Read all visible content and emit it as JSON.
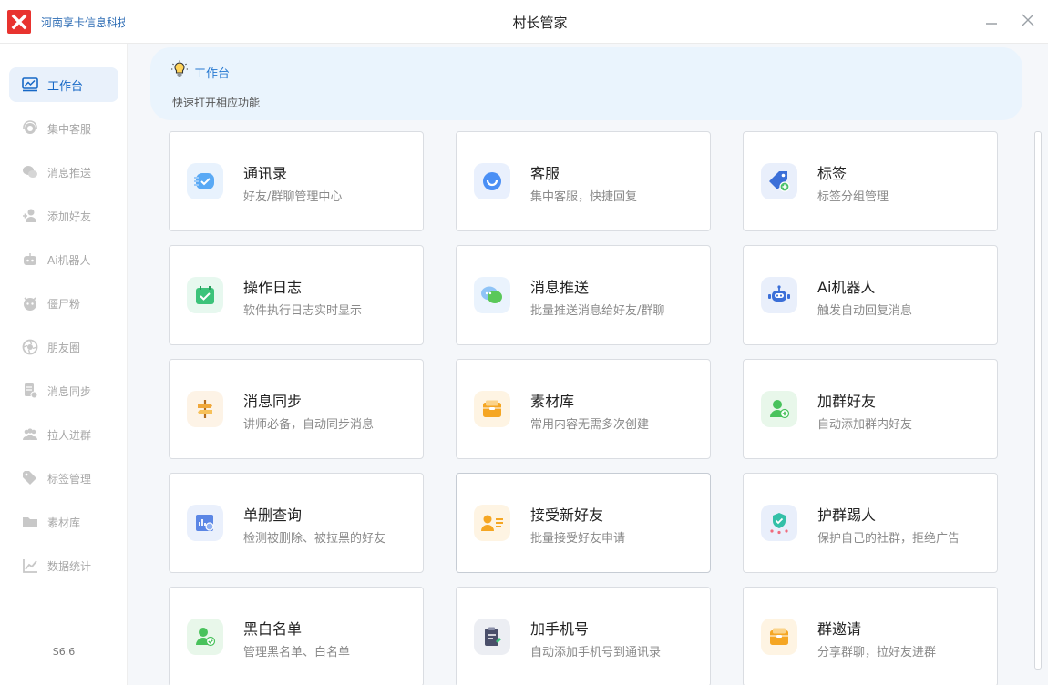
{
  "window": {
    "company": "河南享卡信息科技",
    "title": "村长管家",
    "version": "S6.6"
  },
  "sidebar": {
    "items": [
      {
        "label": "工作台",
        "icon": "workbench-icon",
        "active": true
      },
      {
        "label": "集中客服",
        "icon": "customer-service-icon"
      },
      {
        "label": "消息推送",
        "icon": "chat-bubbles-icon"
      },
      {
        "label": "添加好友",
        "icon": "add-friend-icon"
      },
      {
        "label": "Ai机器人",
        "icon": "robot-icon"
      },
      {
        "label": "僵尸粉",
        "icon": "zombie-icon"
      },
      {
        "label": "朋友圈",
        "icon": "aperture-icon"
      },
      {
        "label": "消息同步",
        "icon": "sync-doc-icon"
      },
      {
        "label": "拉人进群",
        "icon": "group-icon"
      },
      {
        "label": "标签管理",
        "icon": "tag-icon"
      },
      {
        "label": "素材库",
        "icon": "folder-icon"
      },
      {
        "label": "数据统计",
        "icon": "chart-icon"
      }
    ]
  },
  "banner": {
    "title": "工作台",
    "subtitle": "快速打开相应功能",
    "icon": "lightbulb-icon"
  },
  "cards": [
    {
      "title": "通讯录",
      "desc": "好友/群聊管理中心",
      "icon": "contacts-icon",
      "color": "#4a9ff5"
    },
    {
      "title": "客服",
      "desc": "集中客服，快捷回复",
      "icon": "service-icon",
      "color": "#4a8ff5"
    },
    {
      "title": "标签",
      "desc": "标签分组管理",
      "icon": "tag-icon",
      "color": "#3b6fd8"
    },
    {
      "title": "操作日志",
      "desc": "软件执行日志实时显示",
      "icon": "calendar-check-icon",
      "color": "#3cc37a"
    },
    {
      "title": "消息推送",
      "desc": "批量推送消息给好友/群聊",
      "icon": "chat-icon",
      "color": "#5ac85a"
    },
    {
      "title": "Ai机器人",
      "desc": "触发自动回复消息",
      "icon": "robot-icon",
      "color": "#3b6fd8"
    },
    {
      "title": "消息同步",
      "desc": "讲师必备，自动同步消息",
      "icon": "signpost-icon",
      "color": "#f0a83c"
    },
    {
      "title": "素材库",
      "desc": "常用内容无需多次创建",
      "icon": "folder-icon",
      "color": "#f5a623"
    },
    {
      "title": "加群好友",
      "desc": "自动添加群内好友",
      "icon": "add-user-icon",
      "color": "#49c25c"
    },
    {
      "title": "单删查询",
      "desc": "检测被删除、被拉黑的好友",
      "icon": "report-icon",
      "color": "#5b86e5"
    },
    {
      "title": "接受新好友",
      "desc": "批量接受好友申请",
      "icon": "id-card-icon",
      "color": "#f5a623"
    },
    {
      "title": "护群踢人",
      "desc": "保护自己的社群，拒绝广告",
      "icon": "shield-icon",
      "color": "#33c0a8"
    },
    {
      "title": "黑白名单",
      "desc": "管理黑名单、白名单",
      "icon": "user-check-icon",
      "color": "#49c25c"
    },
    {
      "title": "加手机号",
      "desc": "自动添加手机号到通讯录",
      "icon": "clipboard-icon",
      "color": "#4a4f6a"
    },
    {
      "title": "群邀请",
      "desc": "分享群聊，拉好友进群",
      "icon": "folder-icon",
      "color": "#f5a623"
    }
  ]
}
